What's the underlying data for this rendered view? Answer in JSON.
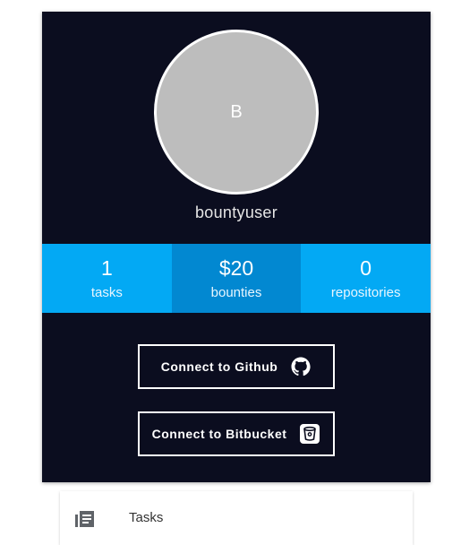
{
  "profile": {
    "avatar_initial": "B",
    "username": "bountyuser"
  },
  "stats": [
    {
      "value": "1",
      "label": "tasks"
    },
    {
      "value": "$20",
      "label": "bounties"
    },
    {
      "value": "0",
      "label": "repositories"
    }
  ],
  "actions": {
    "github_label": "Connect to Github",
    "bitbucket_label": "Connect to Bitbucket"
  },
  "menu": {
    "tasks_label": "Tasks"
  },
  "colors": {
    "card_bg": "#0b0d1f",
    "stat_bg": "#03a9f4",
    "stat_active_bg": "#0288d1",
    "avatar_bg": "#bdbdbd"
  },
  "icons": [
    "github-icon",
    "bitbucket-icon",
    "list-icon"
  ]
}
